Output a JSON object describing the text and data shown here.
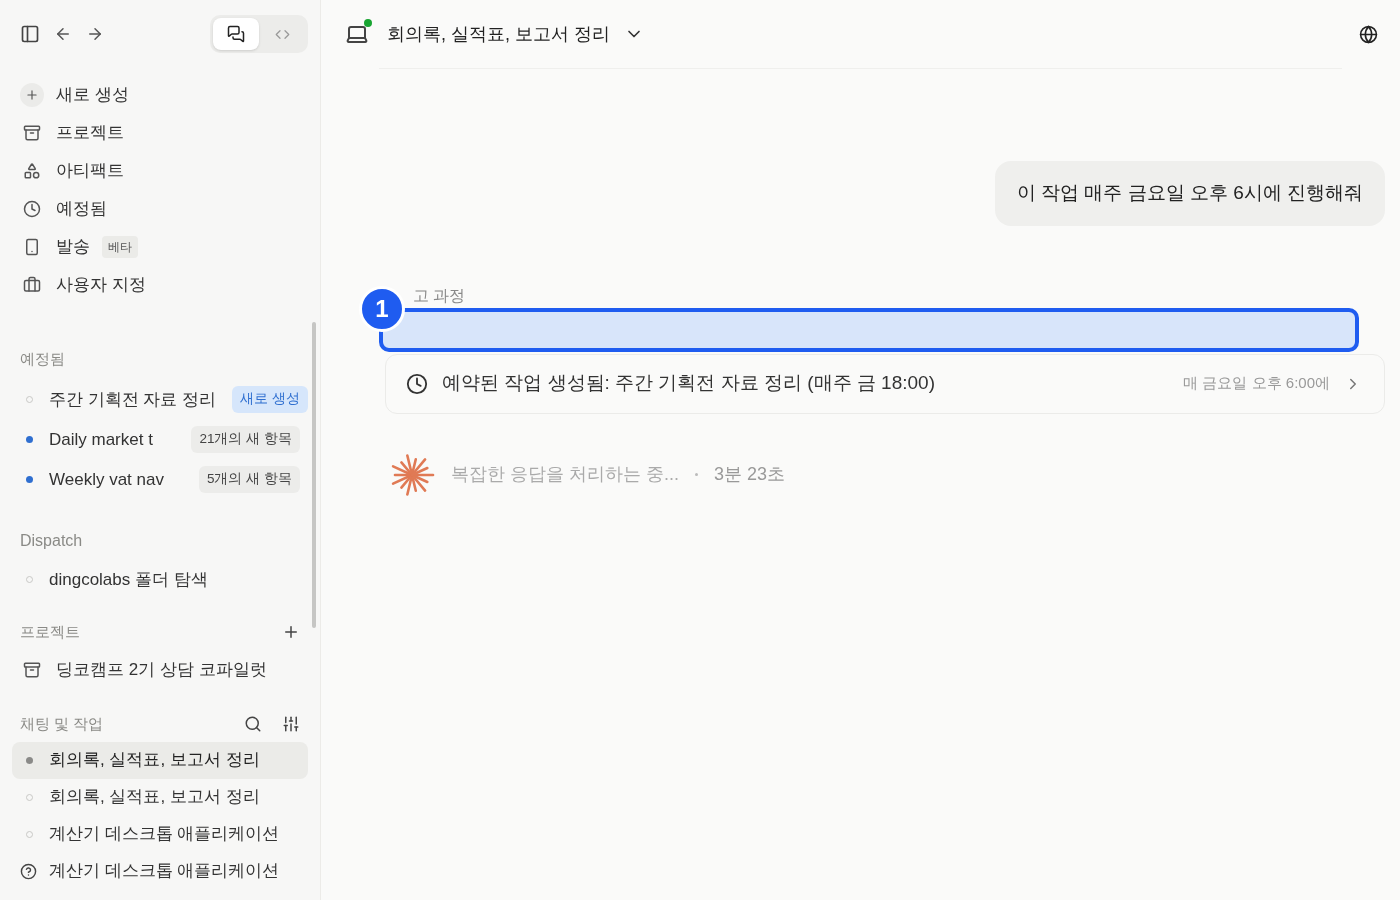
{
  "toolbar": {
    "view_toggle": [
      {
        "kind": "chat",
        "selected": true
      },
      {
        "kind": "code",
        "selected": false
      }
    ]
  },
  "nav": [
    {
      "kind": "plus",
      "label": "새로 생성"
    },
    {
      "kind": "folder",
      "label": "프로젝트"
    },
    {
      "kind": "shapes",
      "label": "아티팩트"
    },
    {
      "kind": "clock",
      "label": "예정됨"
    },
    {
      "kind": "phone",
      "label": "발송",
      "badge": "베타"
    },
    {
      "kind": "briefcase",
      "label": "사용자 지정"
    }
  ],
  "scheduled": {
    "heading": "예정됨",
    "items": [
      {
        "label": "주간 기획전 자료 정리",
        "badge": "새로 생성",
        "kind": "new",
        "unread": false
      },
      {
        "label": "Daily market t",
        "badge": "21개의 새 항목",
        "kind": "count",
        "unread": true
      },
      {
        "label": "Weekly vat nav",
        "badge": "5개의 새 항목",
        "kind": "count",
        "unread": true
      }
    ]
  },
  "dispatch": {
    "heading": "Dispatch",
    "items": [
      {
        "label": "dingcolabs 폴더 탐색",
        "unread": false
      }
    ]
  },
  "projects": {
    "heading": "프로젝트",
    "items": [
      {
        "label": "딩코캠프 2기 상담 코파일럿"
      }
    ]
  },
  "chats": {
    "heading": "채팅 및 작업",
    "items": [
      {
        "label": "회의록, 실적표, 보고서 정리",
        "selected": true,
        "kind": "dot"
      },
      {
        "label": "회의록, 실적표, 보고서 정리",
        "selected": false,
        "kind": "dot"
      },
      {
        "label": "계산기 데스크톱 애플리케이션",
        "selected": false,
        "kind": "dot"
      },
      {
        "label": "계산기 데스크톱 애플리케이션",
        "selected": false,
        "kind": "question"
      }
    ]
  },
  "header": {
    "title": "회의록, 실적표, 보고서 정리",
    "online": true
  },
  "messages": [
    {
      "kind": "user",
      "text": "이 작업 매주 금요일 오후 6시에 진행해줘"
    },
    {
      "kind": "thinking",
      "label": "고 과정"
    },
    {
      "kind": "scheduled_task",
      "text": "예약된 작업 생성됨: 주간 기획전 자료 정리 (매주 금 18:00)",
      "schedule": "매 금요일 오후 6:00에"
    },
    {
      "kind": "progress",
      "text": "복잡한 응답을 처리하는 중...",
      "elapsed": "3분 23초"
    }
  ],
  "annotation": {
    "number": "1"
  }
}
